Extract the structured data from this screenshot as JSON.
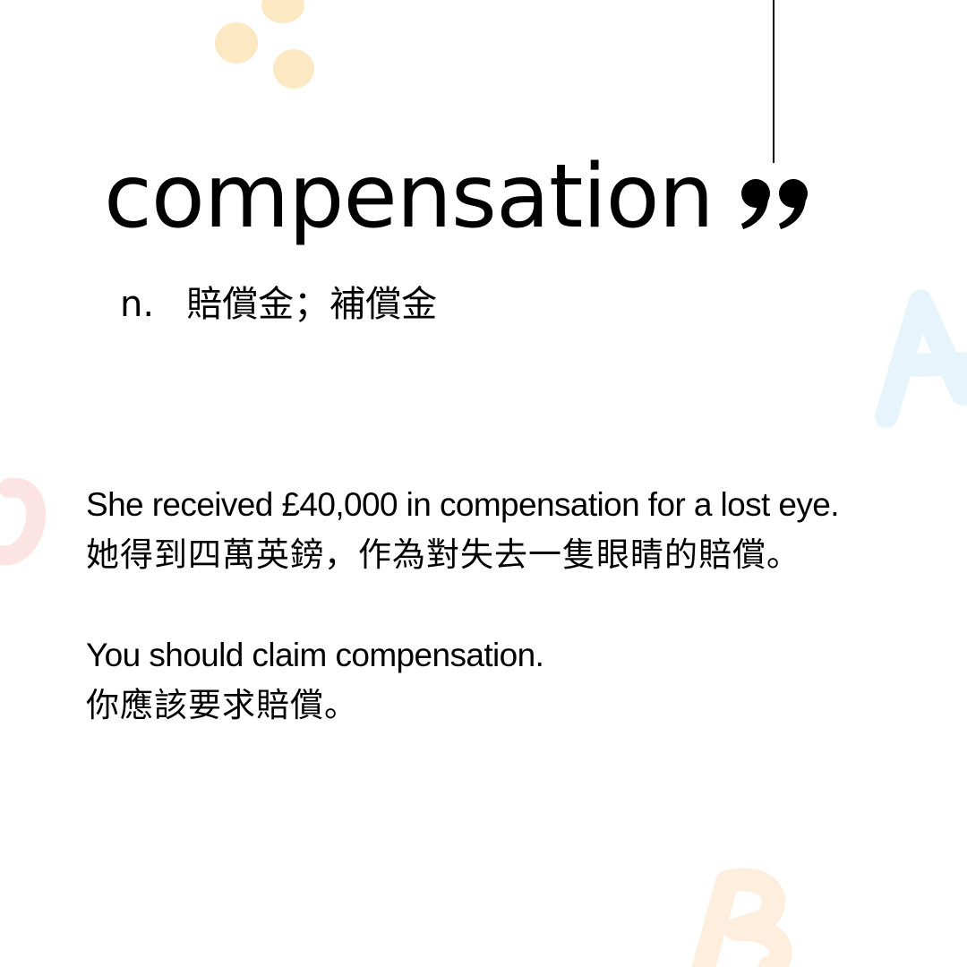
{
  "headword": "compensation",
  "part_of_speech": "n.",
  "definition_zh": "賠償金；補償金",
  "examples": [
    {
      "en": "She received £40,000 in compensation for a lost eye.",
      "zh": "她得到四萬英鎊，作為對失去一隻眼睛的賠償。"
    },
    {
      "en": "You should claim compensation.",
      "zh": "你應該要求賠償。"
    }
  ],
  "colors": {
    "text": "#000000",
    "dots": "#fde8c4",
    "letter_a": "#e6f5fb",
    "letter_c": "#fde4e4",
    "letter_b": "#fdeede"
  },
  "decorations": [
    "dot-cluster",
    "letter-a",
    "letter-c",
    "letter-b",
    "quote-mark-icon",
    "vertical-line"
  ]
}
